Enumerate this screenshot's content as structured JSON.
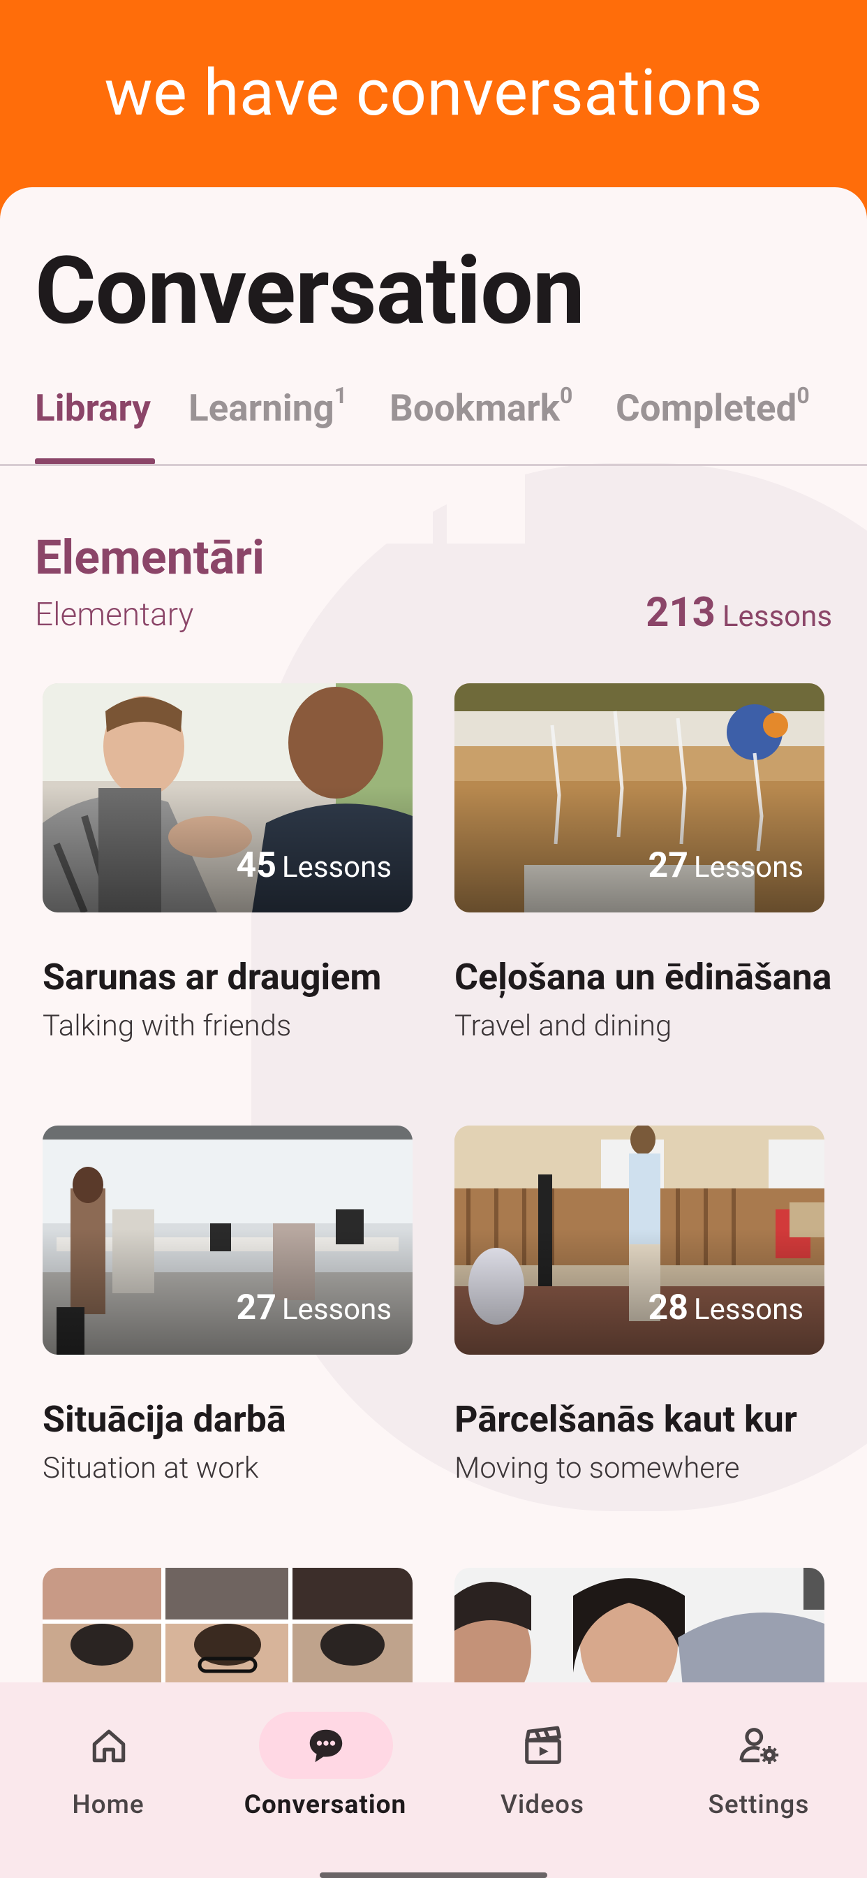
{
  "banner": {
    "text": "we have conversations"
  },
  "page": {
    "title": "Conversation"
  },
  "tabs": [
    {
      "label": "Library",
      "count": ""
    },
    {
      "label": "Learning",
      "count": "1"
    },
    {
      "label": "Bookmark",
      "count": "0"
    },
    {
      "label": "Completed",
      "count": "0"
    }
  ],
  "section": {
    "title": "Elementāri",
    "subtitle": "Elementary",
    "count": "213",
    "count_label": "Lessons"
  },
  "cards": [
    {
      "title": "Sarunas ar draugiem",
      "subtitle": "Talking with friends",
      "count": "45",
      "count_label": "Lessons"
    },
    {
      "title": "Ceļošana un ēdināšana",
      "subtitle": "Travel and dining",
      "count": "27",
      "count_label": "Lessons"
    },
    {
      "title": "Situācija darbā",
      "subtitle": "Situation at work",
      "count": "27",
      "count_label": "Lessons"
    },
    {
      "title": "Pārcelšanās kaut kur",
      "subtitle": "Moving to somewhere",
      "count": "28",
      "count_label": "Lessons"
    }
  ],
  "nav": [
    {
      "label": "Home",
      "icon": "home-icon"
    },
    {
      "label": "Conversation",
      "icon": "chat-bubble-icon"
    },
    {
      "label": "Videos",
      "icon": "clapperboard-icon"
    },
    {
      "label": "Settings",
      "icon": "user-settings-icon"
    }
  ],
  "colors": {
    "banner": "#ff6d0a",
    "accent": "#8b4568",
    "nav_background": "#fae8ec",
    "nav_active_pill": "#ffd8e4"
  }
}
